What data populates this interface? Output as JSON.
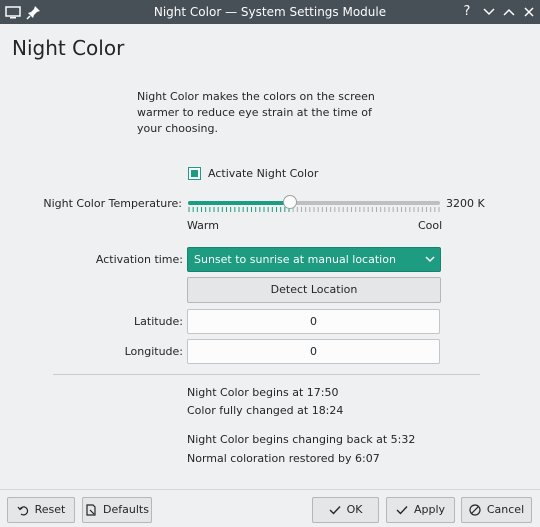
{
  "window": {
    "title": "Night Color — System Settings Module",
    "controls": [
      "help-icon",
      "minimize-icon",
      "maximize-icon",
      "close-icon"
    ]
  },
  "page": {
    "title": "Night Color",
    "description": "Night Color makes the colors on the screen warmer to reduce eye strain at the time of your choosing."
  },
  "activate": {
    "label": "Activate Night Color",
    "checked": true
  },
  "temperature": {
    "label": "Night Color Temperature:",
    "value_text": "3200 K",
    "value": 3200,
    "level": 0.4,
    "warm_label": "Warm",
    "cool_label": "Cool"
  },
  "activation": {
    "label": "Activation time:",
    "selected": "Sunset to sunrise at manual location",
    "detect_button": "Detect Location"
  },
  "location": {
    "latitude_label": "Latitude:",
    "latitude_value": "0",
    "longitude_label": "Longitude:",
    "longitude_value": "0"
  },
  "schedule": {
    "begins": "Night Color begins at 17:50",
    "fully_changed": "Color fully changed at 18:24",
    "changing_back": "Night Color begins changing back at 5:32",
    "restored": "Normal coloration restored by 6:07"
  },
  "footer": {
    "reset": "Reset",
    "defaults": "Defaults",
    "ok": "OK",
    "apply": "Apply",
    "cancel": "Cancel"
  },
  "colors": {
    "accent": "#1d9c82",
    "titlebar": "#475057",
    "background": "#eff0f1"
  }
}
